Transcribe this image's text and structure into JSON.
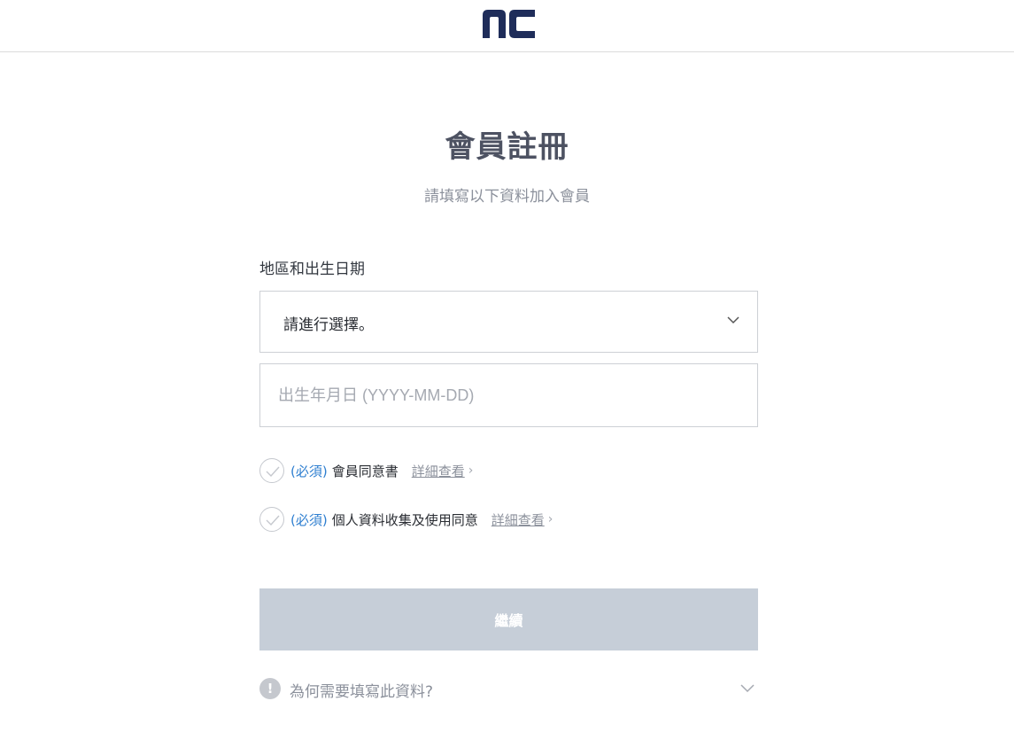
{
  "header": {
    "logo_alt": "nc",
    "brand_color": "#1f2d5a"
  },
  "page": {
    "title": "會員註冊",
    "subtitle": "請填寫以下資料加入會員"
  },
  "form": {
    "section_label": "地區和出生日期",
    "region_select": {
      "selected": "請進行選擇。"
    },
    "birthdate": {
      "placeholder": "出生年月日 (YYYY-MM-DD)",
      "value": ""
    }
  },
  "agreements": [
    {
      "required_label": "(必須)",
      "text": "會員同意書",
      "link": "詳細查看",
      "checked": false
    },
    {
      "required_label": "(必須)",
      "text": "個人資料收集及使用同意",
      "link": "詳細查看",
      "checked": false
    }
  ],
  "continue_button": {
    "label": "繼續",
    "disabled": true
  },
  "why_info": {
    "icon": "!",
    "text": "為何需要填寫此資料?"
  },
  "colors": {
    "accent": "#2f7fd0",
    "button_disabled": "#c6ced8",
    "title": "#4d5262"
  }
}
